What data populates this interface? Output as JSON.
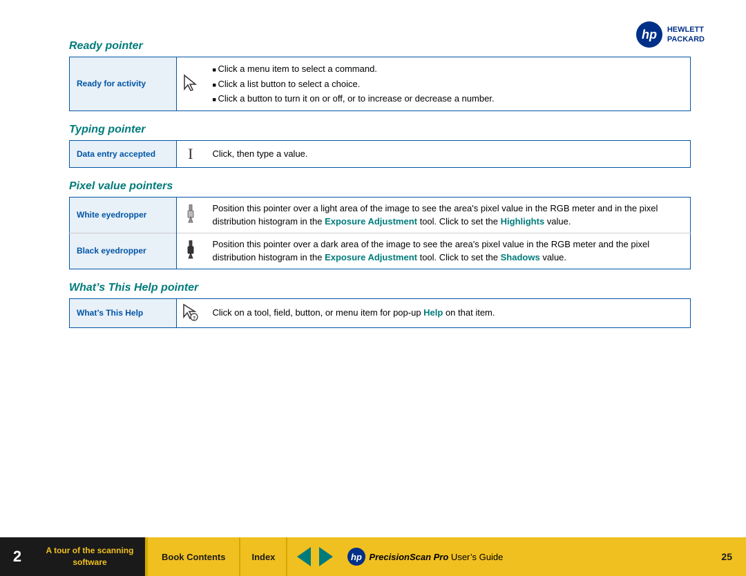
{
  "logo": {
    "symbol": "ℌ",
    "line1": "HEWLETT",
    "line2": "PACKARD"
  },
  "sections": [
    {
      "id": "ready-pointer",
      "heading": "Ready pointer",
      "rows": [
        {
          "label": "Ready for activity",
          "icon": "arrow",
          "description_type": "list",
          "items": [
            "Click a menu item to select a command.",
            "Click a list button to select a choice.",
            "Click a button to turn it on or off, or to increase or decrease a number."
          ]
        }
      ]
    },
    {
      "id": "typing-pointer",
      "heading": "Typing pointer",
      "rows": [
        {
          "label": "Data entry accepted",
          "icon": "ibeam",
          "description_type": "text",
          "text": "Click, then type a value."
        }
      ]
    },
    {
      "id": "pixel-value-pointers",
      "heading": "Pixel value pointers",
      "rows": [
        {
          "label": "White eyedropper",
          "icon": "eyedropper-white",
          "description_type": "mixed",
          "text_before": "Position this pointer over a light area of the image to see the area's pixel value in the RGB meter and in the pixel distribution histogram in the ",
          "link1": "Exposure Adjustment",
          "text_middle": " tool. Click to set the ",
          "link2": "Highlights",
          "text_after": " value."
        },
        {
          "label": "Black eyedropper",
          "icon": "eyedropper-black",
          "description_type": "mixed",
          "text_before": "Position this pointer over a dark area of the image to see the area's pixel value in the RGB meter and the pixel distribution histogram in the ",
          "link1": "Exposure Adjustment",
          "text_middle": " tool. Click to set the ",
          "link2": "Shadows",
          "text_after": " value."
        }
      ]
    },
    {
      "id": "whats-this-help",
      "heading": "What’s This Help pointer",
      "rows": [
        {
          "label": "What’s This Help",
          "icon": "help-cursor",
          "description_type": "mixed-help",
          "text_before": "Click on a tool, field, button, or menu item for pop-up ",
          "link1": "Help",
          "text_after": " on that item."
        }
      ]
    }
  ],
  "bottom_bar": {
    "chapter_num": "2",
    "tour_link": "A tour of the scanning software",
    "book_contents": "Book Contents",
    "index": "Index",
    "brand_hp": "HP",
    "product_italic": "PrecisionScan Pro",
    "product_rest": " User’s Guide",
    "page_num": "25"
  }
}
